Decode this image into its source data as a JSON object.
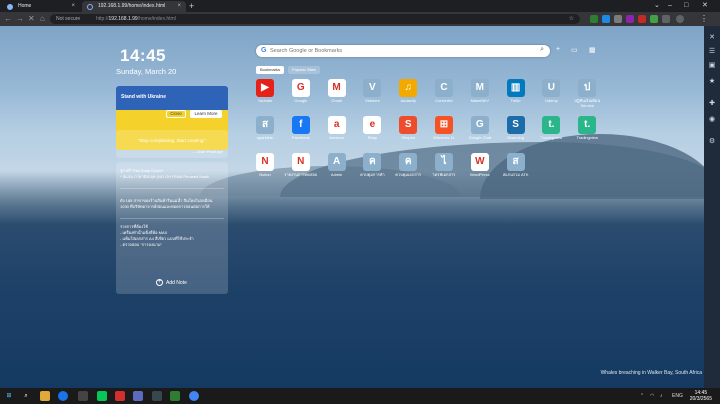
{
  "tabs": [
    {
      "title": "Home",
      "active": false
    },
    {
      "title": "192.168.1.99/home/index.html",
      "active": true
    }
  ],
  "address": {
    "security": "Not secure",
    "protocol": "http://",
    "host": "192.168.1.99",
    "path": "/home/index.html"
  },
  "clock": {
    "time": "14:45",
    "date": "Sunday, March 20"
  },
  "ukraine": {
    "title": "Stand with Ukraine",
    "close_label": "Close",
    "learn_label": "Learn More"
  },
  "quote": {
    "text": "\"Stop complaining. Start creating.\"",
    "author": "— Dale Partridge"
  },
  "notes": [
    {
      "lines": [
        "รูป ฟรี Thai Soap Covid+",
        "* สแกน ภาษาอังกฤษ (NO OHYSMA Phrased Mask"
      ]
    },
    {
      "lines": [
        "ดัง 185 สาขาของร้านสินค้าริมแม่น้ำ สินใหม่ไม่เหมือน",
        "1030 ที่บริษัทอาจารย์สอนและทอดการสอนต่อการให้"
      ]
    },
    {
      "lines": [
        "รายการที่ต้องใช้",
        "- เครื่องทำน้ำแข็งยี่ห้อ MAX",
        "- แฟ้มใส่เอกสาร A4 สีเขียว แบบที่ใช้ประจำ",
        "- ตรวจสอบ \"การลงนาม\""
      ]
    }
  ],
  "add_note_label": "Add Note",
  "search": {
    "placeholder": "Search Google or Bookmarks"
  },
  "bookmark_tabs": {
    "bookmarks": "Bookmarks",
    "popular": "Popular Sites"
  },
  "bookmarks": [
    {
      "label": "Youtube",
      "glyph": "▶",
      "color": "#e62117"
    },
    {
      "label": "Google",
      "glyph": "G",
      "color": "#ffffff"
    },
    {
      "label": "Gmail",
      "glyph": "M",
      "color": "#ffffff"
    },
    {
      "label": "Vidmore",
      "glyph": "V",
      "color": "#8cb0cc"
    },
    {
      "label": "Audacity",
      "glyph": "♫",
      "color": "#f2a900"
    },
    {
      "label": "Converter",
      "glyph": "C",
      "color": "#8cb0cc"
    },
    {
      "label": "MakeMKV",
      "glyph": "M",
      "color": "#8cb0cc"
    },
    {
      "label": "Trello",
      "glyph": "▥",
      "color": "#0079bf"
    },
    {
      "label": "Udemy",
      "glyph": "U",
      "color": "#8cb0cc"
    },
    {
      "label": "ปฏิทินเงินเดือน Service",
      "glyph": "ป",
      "color": "#8cb0cc"
    },
    {
      "label": "sparkline",
      "glyph": "ส",
      "color": "#8cb0cc"
    },
    {
      "label": "Facebook",
      "glyph": "f",
      "color": "#1877f2"
    },
    {
      "label": "Amazon",
      "glyph": "a",
      "color": "#ffffff"
    },
    {
      "label": "Ebay",
      "glyph": "e",
      "color": "#ffffff"
    },
    {
      "label": "Shopee",
      "glyph": "S",
      "color": "#ee4d2d"
    },
    {
      "label": "Windows 11",
      "glyph": "⊞",
      "color": "#f35325"
    },
    {
      "label": "Google Chat",
      "glyph": "G",
      "color": "#8cb0cc"
    },
    {
      "label": "Scanning",
      "glyph": "S",
      "color": "#1b6ca8"
    },
    {
      "label": "Tradingview",
      "glyph": "t.",
      "color": "#2bb58a"
    },
    {
      "label": "Tradingview",
      "glyph": "t.",
      "color": "#2bb58a"
    },
    {
      "label": "Notion",
      "glyph": "N",
      "color": "#ffffff"
    },
    {
      "label": "รายงานการทดสอบ",
      "glyph": "N",
      "color": "#ffffff"
    },
    {
      "label": "Admin",
      "glyph": "A",
      "color": "#8cb0cc"
    },
    {
      "label": "ควบคุมการทำ",
      "glyph": "ค",
      "color": "#8cb0cc"
    },
    {
      "label": "ควบคุมเอกสาร",
      "glyph": "ค",
      "color": "#8cb0cc"
    },
    {
      "label": "ไดรฟ์เอกสาร",
      "glyph": "ไ",
      "color": "#8cb0cc"
    },
    {
      "label": "WordPress",
      "glyph": "W",
      "color": "#ffffff"
    },
    {
      "label": "สแกนรวม ATK",
      "glyph": "ส",
      "color": "#8cb0cc"
    }
  ],
  "credit": "Whales breaching in Walker Bay, South Africa",
  "taskbar": {
    "lang": "ENG",
    "time": "14:45",
    "date": "20/3/2565"
  }
}
